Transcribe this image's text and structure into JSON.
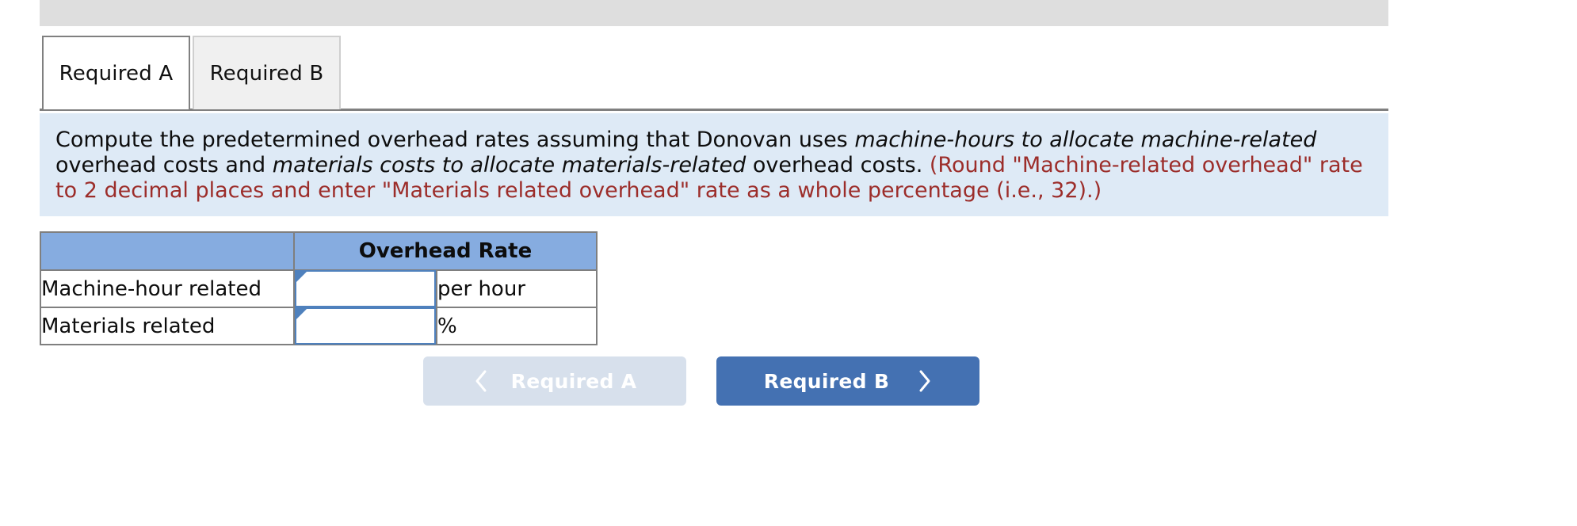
{
  "top_bar": {
    "label": ""
  },
  "tabs": [
    {
      "id": "required-a",
      "label": "Required A",
      "state": "active"
    },
    {
      "id": "required-b",
      "label": "Required B",
      "state": "inactive"
    }
  ],
  "instruction": {
    "segment_1": "Compute the predetermined overhead rates assuming that Donovan uses ",
    "emphasis_1": "machine-hours to allocate machine-related",
    "segment_2": " overhead costs and ",
    "emphasis_2": "materials costs to allocate materials-related",
    "segment_3": " overhead costs. ",
    "note": "(Round \"Machine-related overhead\" rate to 2 decimal places and enter \"Materials related overhead\" rate as a whole percentage (i.e., 32).)"
  },
  "table": {
    "headers": [
      "",
      "Overhead Rate"
    ],
    "rows": [
      {
        "label": "Machine-hour related",
        "value": "",
        "unit": "per hour"
      },
      {
        "label": "Materials related",
        "value": "",
        "unit": "%"
      }
    ]
  },
  "nav": {
    "prev": {
      "label": "Required A",
      "icon": "chevron-left-icon",
      "disabled": true
    },
    "next": {
      "label": "Required B",
      "icon": "chevron-right-icon",
      "disabled": false
    }
  },
  "colors": {
    "header_blue": "#86ace0",
    "panel_blue": "#deeaf6",
    "note_red": "#9c2d2a",
    "primary_button": "#4471b2",
    "disabled_button": "#d7e0ec",
    "input_border": "#4f81bd",
    "top_bar_gray": "#dedede"
  }
}
